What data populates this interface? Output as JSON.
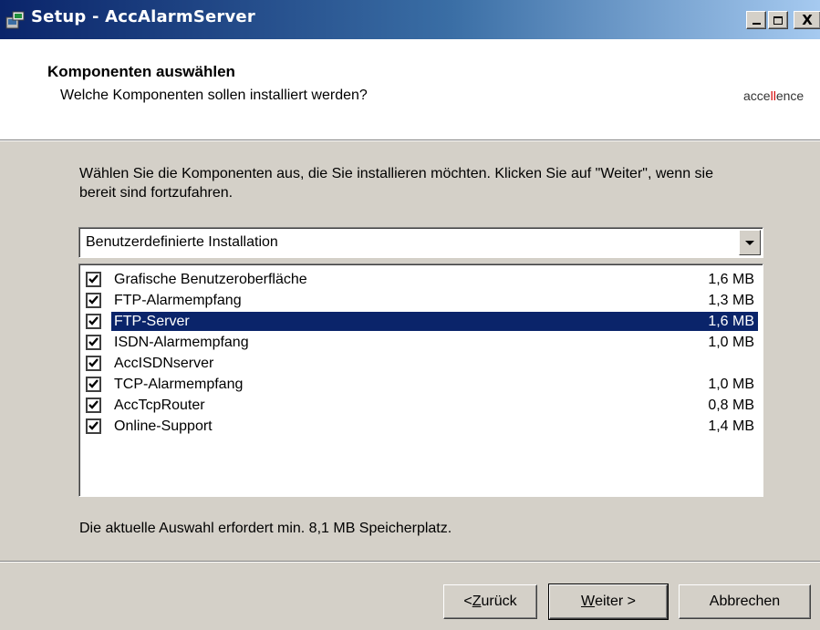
{
  "window": {
    "title": "Setup - AccAlarmServer",
    "controls": {
      "minimize": "_",
      "maximize": "□",
      "close": "X"
    }
  },
  "header": {
    "title": "Komponenten auswählen",
    "subtitle": "Welche Komponenten sollen installiert werden?",
    "logo_pre": "acce",
    "logo_accent": "ll",
    "logo_post": "ence"
  },
  "body": {
    "intro": "Wählen Sie die Komponenten aus, die Sie installieren möchten. Klicken Sie auf \"Weiter\", wenn sie bereit sind fortzufahren.",
    "install_type": "Benutzerdefinierte Installation",
    "components": [
      {
        "label": "Grafische Benutzeroberfläche",
        "size": "1,6 MB",
        "checked": true,
        "selected": false
      },
      {
        "label": "FTP-Alarmempfang",
        "size": "1,3 MB",
        "checked": true,
        "selected": false
      },
      {
        "label": "FTP-Server",
        "size": "1,6 MB",
        "checked": true,
        "selected": true
      },
      {
        "label": "ISDN-Alarmempfang",
        "size": "1,0 MB",
        "checked": true,
        "selected": false
      },
      {
        "label": "AccISDNserver",
        "size": "",
        "checked": true,
        "selected": false
      },
      {
        "label": "TCP-Alarmempfang",
        "size": "1,0 MB",
        "checked": true,
        "selected": false
      },
      {
        "label": "AccTcpRouter",
        "size": "0,8 MB",
        "checked": true,
        "selected": false
      },
      {
        "label": "Online-Support",
        "size": "1,4 MB",
        "checked": true,
        "selected": false
      }
    ],
    "status": "Die aktuelle Auswahl erfordert min. 8,1 MB Speicherplatz."
  },
  "buttons": {
    "back_prefix": "< ",
    "back_accel": "Z",
    "back_rest": "urück",
    "next_accel": "W",
    "next_rest": "eiter >",
    "cancel": "Abbrechen"
  },
  "colors": {
    "titlebar_start": "#0a246a",
    "titlebar_end": "#a6caf0",
    "selection": "#0a246a",
    "dialog_bg": "#d4d0c8",
    "logo_accent": "#d40000"
  }
}
